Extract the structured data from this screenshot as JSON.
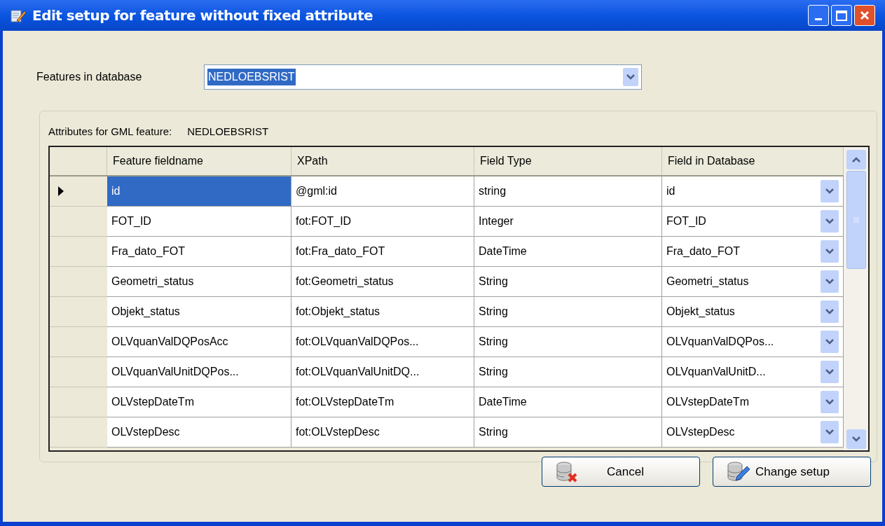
{
  "window": {
    "title": "Edit setup for feature without fixed attribute"
  },
  "features_field": {
    "label": "Features in database",
    "value": "NEDLOEBSRIST"
  },
  "group": {
    "label": "Attributes for GML feature:",
    "feature": "NEDLOEBSRIST"
  },
  "table": {
    "columns": [
      "Feature fieldname",
      "XPath",
      "Field Type",
      "Field in Database"
    ],
    "rows": [
      {
        "selected": true,
        "cells": [
          "id",
          "@gml:id",
          "string",
          "id"
        ]
      },
      {
        "selected": false,
        "cells": [
          "FOT_ID",
          "fot:FOT_ID",
          "Integer",
          "FOT_ID"
        ]
      },
      {
        "selected": false,
        "cells": [
          "Fra_dato_FOT",
          "fot:Fra_dato_FOT",
          "DateTime",
          "Fra_dato_FOT"
        ]
      },
      {
        "selected": false,
        "cells": [
          "Geometri_status",
          "fot:Geometri_status",
          "String",
          "Geometri_status"
        ]
      },
      {
        "selected": false,
        "cells": [
          "Objekt_status",
          "fot:Objekt_status",
          "String",
          "Objekt_status"
        ]
      },
      {
        "selected": false,
        "cells": [
          "OLVquanValDQPosAcc",
          "fot:OLVquanValDQPos...",
          "String",
          "OLVquanValDQPos..."
        ]
      },
      {
        "selected": false,
        "cells": [
          "OLVquanValUnitDQPos...",
          "fot:OLVquanValUnitDQ...",
          "String",
          "OLVquanValUnitD..."
        ]
      },
      {
        "selected": false,
        "cells": [
          "OLVstepDateTm",
          "fot:OLVstepDateTm",
          "DateTime",
          "OLVstepDateTm"
        ]
      },
      {
        "selected": false,
        "cells": [
          "OLVstepDesc",
          "fot:OLVstepDesc",
          "String",
          "OLVstepDesc"
        ]
      }
    ]
  },
  "buttons": [
    "Cancel",
    "Change setup"
  ]
}
